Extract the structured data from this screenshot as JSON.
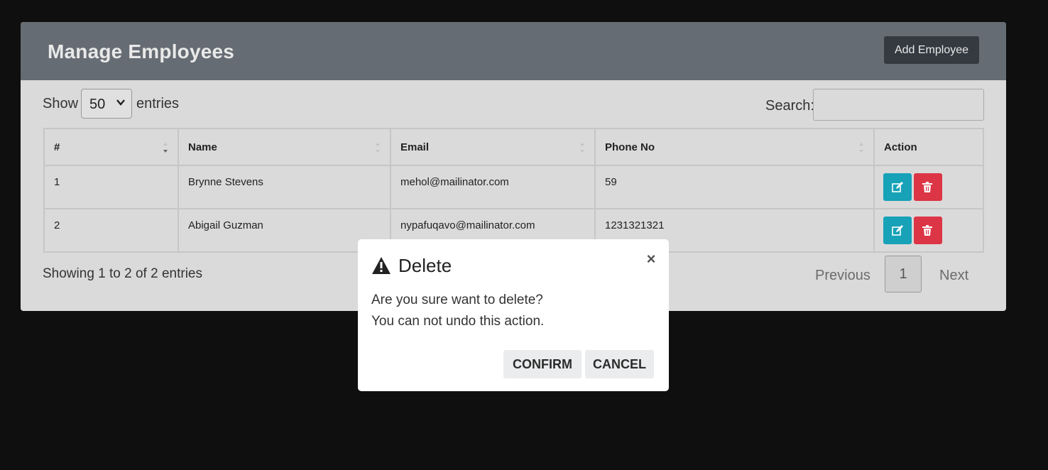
{
  "header": {
    "title": "Manage Employees",
    "add_button_label": "Add Employee"
  },
  "controls": {
    "show_label": "Show",
    "page_length": "50",
    "entries_label": "entries",
    "search_label": "Search:",
    "search_value": ""
  },
  "table": {
    "columns": [
      "#",
      "Name",
      "Email",
      "Phone No",
      "Action"
    ],
    "rows": [
      {
        "num": "1",
        "name": "Brynne Stevens",
        "email": "mehol@mailinator.com",
        "phone": "59"
      },
      {
        "num": "2",
        "name": "Abigail Guzman",
        "email": "nypafuqavo@mailinator.com",
        "phone": "1231321321"
      }
    ]
  },
  "footer": {
    "info": "Showing 1 to 2 of 2 entries",
    "previous_label": "Previous",
    "current_page": "1",
    "next_label": "Next"
  },
  "modal": {
    "title": "Delete",
    "close_symbol": "×",
    "line1": "Are you sure want to delete?",
    "line2": "You can not undo this action.",
    "confirm_label": "CONFIRM",
    "cancel_label": "CANCEL"
  },
  "icons": {
    "warning": "warning-icon",
    "close": "close-icon",
    "edit": "edit-icon",
    "delete": "trash-icon",
    "select_caret": "chevron-down-icon",
    "sort": "sort-icon"
  },
  "colors": {
    "header_bg": "#666c73",
    "panel_bg": "#dadada",
    "add_button_bg": "#343a40",
    "edit_button_bg": "#17a2b8",
    "delete_button_bg": "#dc3545",
    "page_bg": "#0f0f0f"
  }
}
